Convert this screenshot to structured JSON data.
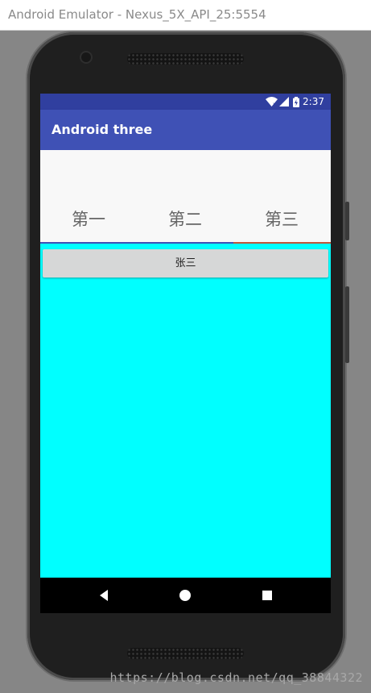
{
  "window": {
    "title": "Android Emulator - Nexus_5X_API_25:5554"
  },
  "status_bar": {
    "time": "2:37",
    "icons": [
      "wifi-icon",
      "signal-icon",
      "battery-icon"
    ]
  },
  "app_bar": {
    "title": "Android three"
  },
  "tabs": [
    {
      "label": "第一",
      "selected": false
    },
    {
      "label": "第二",
      "selected": false
    },
    {
      "label": "第三",
      "selected": true
    }
  ],
  "content": {
    "button_label": "张三",
    "background": "#00ffff"
  },
  "nav_bar": {
    "buttons": [
      "back-icon",
      "home-icon",
      "recents-icon"
    ]
  },
  "watermark": "https://blog.csdn.net/qq_38844322",
  "colors": {
    "status_bar": "#303f9f",
    "app_bar": "#3f51b5",
    "tab_indicator_blue": "#3f51b5",
    "tab_indicator_selected": "#c0563a"
  }
}
